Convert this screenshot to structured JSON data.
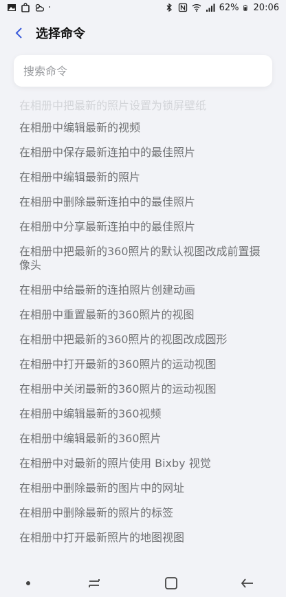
{
  "status_bar": {
    "battery_percent": "62%",
    "time": "20:06"
  },
  "header": {
    "title": "选择命令"
  },
  "search": {
    "placeholder": "搜索命令"
  },
  "partial_item": "在相册中把最新的照片设置为锁屏壁纸",
  "commands": [
    "在相册中编辑最新的视频",
    "在相册中保存最新连拍中的最佳照片",
    "在相册中编辑最新的照片",
    "在相册中删除最新连拍中的最佳照片",
    "在相册中分享最新连拍中的最佳照片",
    "在相册中把最新的360照片的默认视图改成前置摄像头",
    "在相册中给最新的连拍照片创建动画",
    "在相册中重置最新的360照片的视图",
    "在相册中把最新的360照片的视图改成圆形",
    "在相册中打开最新的360照片的运动视图",
    "在相册中关闭最新的360照片的运动视图",
    "在相册中编辑最新的360视频",
    "在相册中编辑最新的360照片",
    "在相册中对最新的照片使用 Bixby 视觉",
    "在相册中删除最新的图片中的网址",
    "在相册中删除最新的照片的标签",
    "在相册中打开最新照片的地图视图"
  ]
}
